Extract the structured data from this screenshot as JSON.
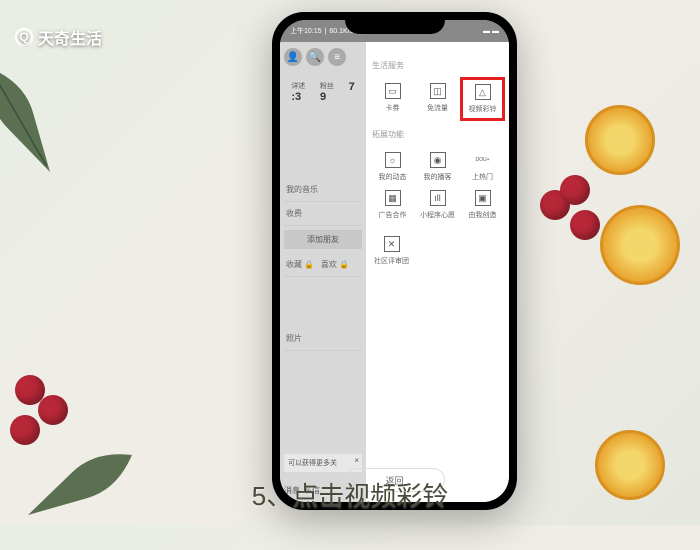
{
  "watermark": "天奇生活",
  "status": {
    "time": "上午10:15",
    "speed": "60.1K/s"
  },
  "left": {
    "stat1_label": "详述",
    "stat1_val": ":3",
    "stat2_label": "粉丝",
    "stat2_val": "9",
    "stat3_label": "",
    "stat3_val": "7",
    "music": "我的音乐",
    "vip": "收费",
    "add_friend": "添加朋友",
    "no_view": "收藏",
    "like": "喜欢",
    "photo": "照片",
    "more": "可以获得更多关",
    "msg": "消息",
    "chat": "私信"
  },
  "sections": {
    "life": "生活服务",
    "extend": "拓展功能"
  },
  "life_items": [
    {
      "label": "卡券",
      "icon": "▭"
    },
    {
      "label": "免流量",
      "icon": "◫"
    },
    {
      "label": "视频彩铃",
      "icon": "△",
      "highlight": true
    }
  ],
  "extend_items": [
    {
      "label": "我的动态",
      "icon": "☼"
    },
    {
      "label": "我的播客",
      "icon": "◉"
    },
    {
      "label": "上热门",
      "icon": "DOU+"
    },
    {
      "label": "广告合作",
      "icon": "▦"
    },
    {
      "label": "小程序心愿",
      "icon": "ıll"
    },
    {
      "label": "由我创造",
      "icon": "▣"
    },
    {
      "label": "社区评审团",
      "icon": "✕"
    }
  ],
  "return_btn": "返回",
  "caption": "5、点击视频彩铃"
}
